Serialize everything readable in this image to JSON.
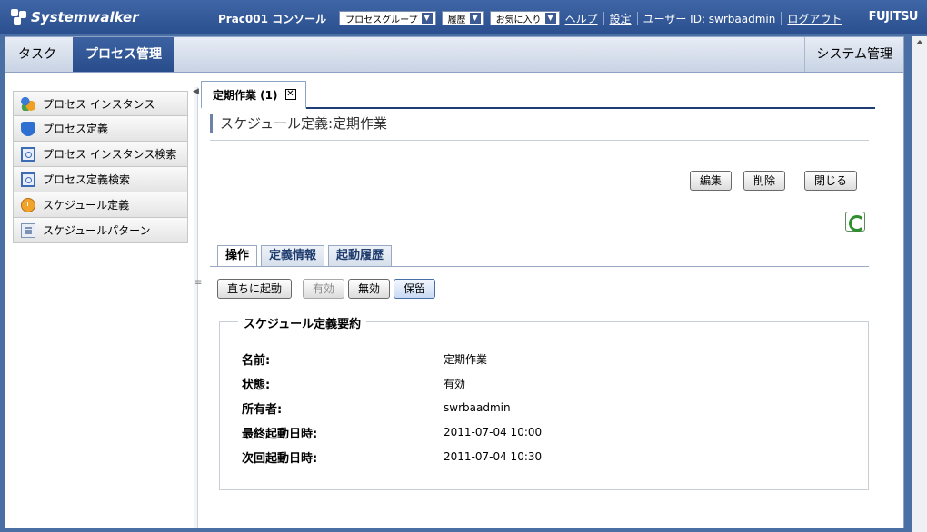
{
  "header": {
    "logo_text": "Systemwalker",
    "app_name": "Prac001 コンソール",
    "dropdowns": [
      {
        "label": "プロセスグループ"
      },
      {
        "label": "履歴"
      },
      {
        "label": "お気に入り"
      }
    ],
    "links": {
      "help": "ヘルプ",
      "settings": "設定",
      "user": "ユーザー ID: swrbaadmin",
      "logout": "ログアウト"
    },
    "brand": "FUJITSU"
  },
  "main_tabs": {
    "task": "タスク",
    "process_mgmt": "プロセス管理",
    "system_mgmt": "システム管理"
  },
  "sidebar": {
    "items": [
      {
        "label": "プロセス インスタンス",
        "icon": "process-instance-icon"
      },
      {
        "label": "プロセス定義",
        "icon": "process-definition-icon"
      },
      {
        "label": "プロセス インスタンス検索",
        "icon": "instance-search-icon"
      },
      {
        "label": "プロセス定義検索",
        "icon": "definition-search-icon"
      },
      {
        "label": "スケジュール定義",
        "icon": "schedule-definition-icon"
      },
      {
        "label": "スケジュールパターン",
        "icon": "schedule-pattern-icon"
      }
    ]
  },
  "panel": {
    "doc_tab": "定期作業 (1)",
    "title": "スケジュール定義:定期作業",
    "actions": {
      "edit": "編集",
      "delete": "削除",
      "close": "閉じる"
    },
    "subtabs": [
      "操作",
      "定義情報",
      "起動履歴"
    ],
    "operations": {
      "start_now": "直ちに起動",
      "enable": "有効",
      "disable": "無効",
      "hold": "保留"
    },
    "summary": {
      "legend": "スケジュール定義要約",
      "rows": [
        {
          "label": "名前:",
          "value": "定期作業"
        },
        {
          "label": "状態:",
          "value": "有効"
        },
        {
          "label": "所有者:",
          "value": "swrbaadmin"
        },
        {
          "label": "最終起動日時:",
          "value": "2011-07-04 10:00"
        },
        {
          "label": "次回起動日時:",
          "value": "2011-07-04 10:30"
        }
      ]
    }
  }
}
